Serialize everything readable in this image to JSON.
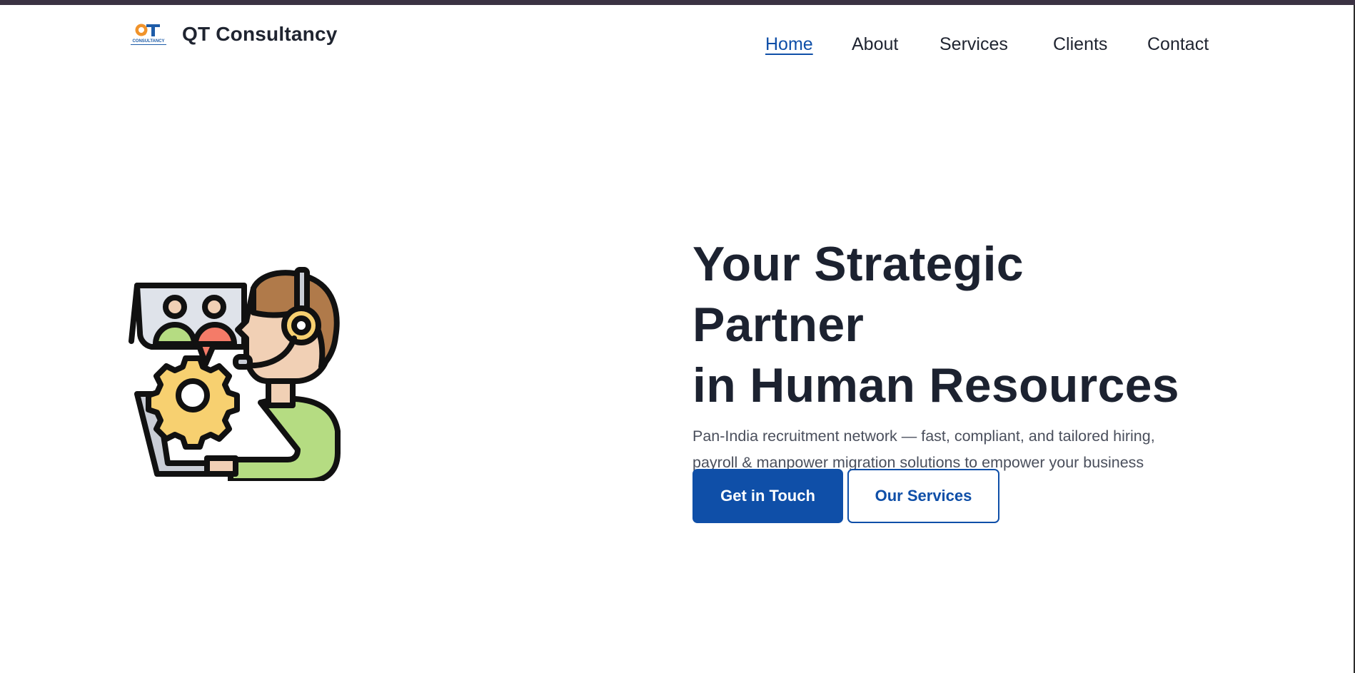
{
  "brand": {
    "name": "QT Consultancy",
    "logo_letters": "QT",
    "logo_caption": "CONSULTANCY",
    "colors": {
      "q": "#f0932b",
      "t": "#1e5ca8"
    }
  },
  "nav": {
    "items": [
      {
        "label": "Home",
        "active": true
      },
      {
        "label": "About",
        "active": false
      },
      {
        "label": "Services",
        "active": false
      },
      {
        "label": "Clients",
        "active": false
      },
      {
        "label": "Contact",
        "active": false
      }
    ],
    "active_color": "#0f4fa8"
  },
  "hero": {
    "title_line1": "Your Strategic Partner",
    "title_line2": "in Human Resources",
    "subtitle": "Pan-India recruitment network — fast, compliant, and tailored hiring, payroll & manpower migration solutions to empower your business growth.",
    "image_icon": "hr-support-agent-illustration",
    "primary_button": "Get in Touch",
    "secondary_button": "Our Services"
  },
  "colors": {
    "accent": "#0f4fa8",
    "top_bar": "#3b3243",
    "heading": "#1c2230",
    "body_text": "#4a4f5c"
  }
}
